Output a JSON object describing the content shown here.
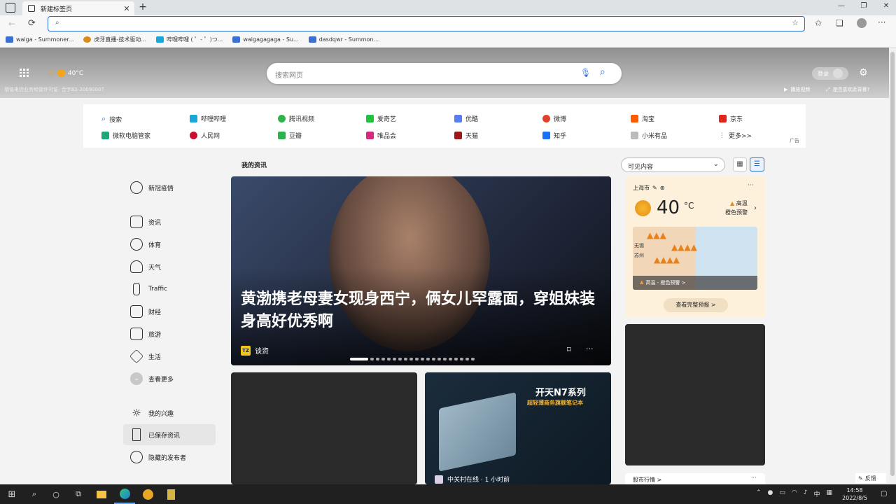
{
  "browser": {
    "tab_title": "新建标签页",
    "new_tab": "+",
    "address_value": "",
    "window_controls": [
      "—",
      "❐",
      "✕"
    ]
  },
  "bookmarks": [
    "waiga - Summoner...",
    "虎牙直播-技术驱动...",
    "哔哩哔哩 ( ゜- ゜)つ...",
    "waigagagaga - Su...",
    "dasdqwr - Summon..."
  ],
  "hero": {
    "weather_temp": "40°C",
    "license": "增值电信业务经营许可证: 合字B2-20090007",
    "search_placeholder": "搜索网页",
    "login": "登录",
    "play_video": "播放视频",
    "like_bg": "是否喜欢此背景?"
  },
  "quick_links": {
    "row1": [
      "搜索",
      "哔哩哔哩",
      "腾讯视频",
      "爱奇艺",
      "优酷",
      "微博",
      "淘宝",
      "京东"
    ],
    "row2": [
      "微软电脑管家",
      "人民网",
      "豆瓣",
      "唯品会",
      "天猫",
      "知乎",
      "小米有品",
      "更多>>"
    ],
    "ad": "广告"
  },
  "sidebar": {
    "items": [
      "新冠疫情",
      "资讯",
      "体育",
      "天气",
      "Traffic",
      "财经",
      "旅游",
      "生活",
      "查看更多",
      "我的兴趣",
      "已保存资讯",
      "隐藏的发布者"
    ]
  },
  "feed": {
    "section_title": "我的资讯",
    "filter": "可见内容",
    "headline": "黄渤携老母妻女现身西宁，俩女儿罕露面，穿姐妹装身高好优秀啊",
    "source": "谈资",
    "card2_ad_title": "开天N7系列",
    "card2_ad_subtitle": "超轻薄商务旗舰笔记本",
    "card2_source": "中关村在线 · 1 小时前"
  },
  "weather": {
    "city": "上海市",
    "temp": "40",
    "unit": "°C",
    "alert_line1": "高温",
    "alert_line2": "橙色预警",
    "map_alert": "高温 - 橙色预警 >",
    "full_forecast": "查看完整预报 >",
    "map_label_a": "无锡",
    "map_label_b": "苏州"
  },
  "bottom_labels": {
    "stock": "股市行情 >",
    "feedback": "反馈"
  },
  "taskbar": {
    "time": "14:58",
    "date": "2022/8/5",
    "ime": "中"
  }
}
